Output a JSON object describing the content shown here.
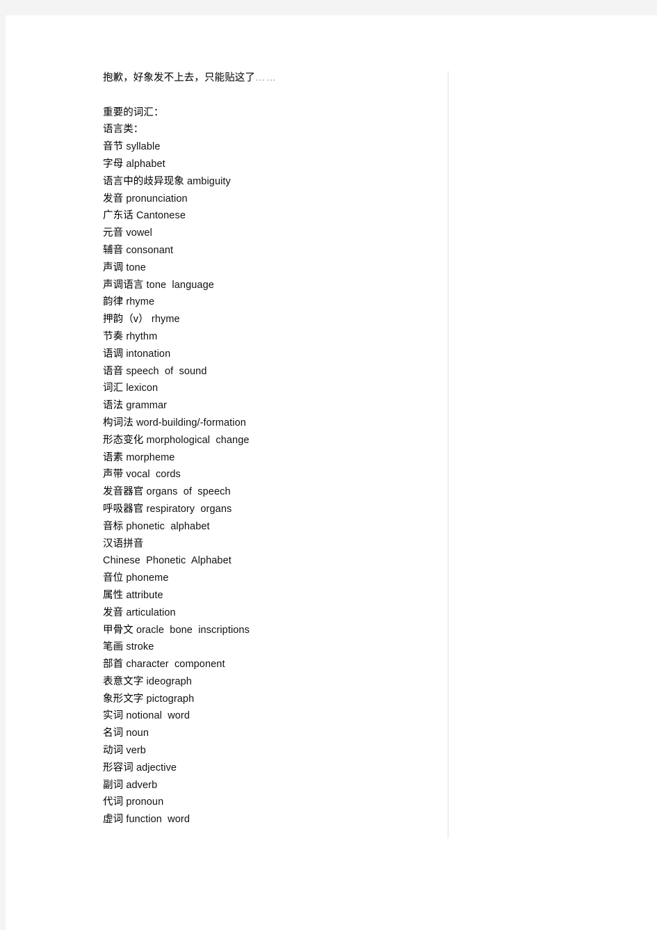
{
  "document": {
    "intro": {
      "text_cn": "抱歉，好象发不上去，只能贴这了",
      "ellipsis": "……"
    },
    "heading_1": "重要的词汇：",
    "heading_2": "语言类：",
    "entries": [
      {
        "cn": "音节",
        "en": "syllable"
      },
      {
        "cn": "字母",
        "en": "alphabet"
      },
      {
        "cn": "语言中的歧异现象",
        "en": "ambiguity"
      },
      {
        "cn": "发音",
        "en": "pronunciation"
      },
      {
        "cn": "广东话",
        "en": "Cantonese"
      },
      {
        "cn": "元音",
        "en": "vowel"
      },
      {
        "cn": "辅音",
        "en": "consonant"
      },
      {
        "cn": "声调",
        "en": "tone"
      },
      {
        "cn": "声调语言",
        "en": "tone  language"
      },
      {
        "cn": "韵律",
        "en": "rhyme"
      },
      {
        "cn": "押韵（v）",
        "en": "rhyme"
      },
      {
        "cn": "节奏",
        "en": "rhythm"
      },
      {
        "cn": "语调",
        "en": "intonation"
      },
      {
        "cn": "语音",
        "en": "speech  of  sound"
      },
      {
        "cn": "词汇",
        "en": "lexicon"
      },
      {
        "cn": "语法",
        "en": "grammar"
      },
      {
        "cn": "构词法",
        "en": "word-building/-formation"
      },
      {
        "cn": "形态变化",
        "en": "morphological  change"
      },
      {
        "cn": "语素",
        "en": "morpheme"
      },
      {
        "cn": "声带",
        "en": "vocal  cords"
      },
      {
        "cn": "发音器官",
        "en": "organs  of  speech"
      },
      {
        "cn": "呼吸器官",
        "en": "respiratory  organs"
      },
      {
        "cn": "音标",
        "en": "phonetic  alphabet"
      },
      {
        "cn": "汉语拼音",
        "en": ""
      },
      {
        "cn": "",
        "en": "Chinese  Phonetic  Alphabet"
      },
      {
        "cn": "音位",
        "en": "phoneme"
      },
      {
        "cn": "属性",
        "en": "attribute"
      },
      {
        "cn": "发音",
        "en": "articulation"
      },
      {
        "cn": "甲骨文",
        "en": "oracle  bone  inscriptions"
      },
      {
        "cn": "笔画",
        "en": "stroke"
      },
      {
        "cn": "部首",
        "en": "character  component"
      },
      {
        "cn": "表意文字",
        "en": "ideograph"
      },
      {
        "cn": "象形文字",
        "en": "pictograph"
      },
      {
        "cn": "实词",
        "en": "notional  word"
      },
      {
        "cn": "名词",
        "en": "noun"
      },
      {
        "cn": "动词",
        "en": "verb"
      },
      {
        "cn": "形容词",
        "en": "adjective"
      },
      {
        "cn": "副词",
        "en": "adverb"
      },
      {
        "cn": "代词",
        "en": "pronoun"
      },
      {
        "cn": "虚词",
        "en": "function  word"
      }
    ]
  }
}
